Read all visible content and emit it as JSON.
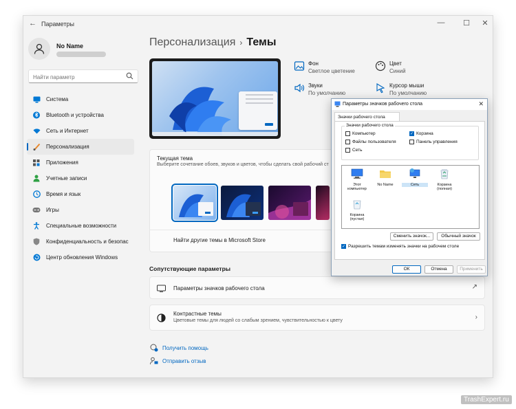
{
  "window": {
    "title": "Параметры",
    "minimize": "—",
    "maximize": "☐",
    "close": "✕",
    "back": "←"
  },
  "profile": {
    "name": "No Name"
  },
  "search": {
    "placeholder": "Найти параметр"
  },
  "sidebar": {
    "items": [
      {
        "label": "Система",
        "icon": "monitor-icon",
        "color": "#0078d4"
      },
      {
        "label": "Bluetooth и устройства",
        "icon": "bluetooth-icon",
        "color": "#0078d4"
      },
      {
        "label": "Сеть и Интернет",
        "icon": "wifi-icon",
        "color": "#0078d4"
      },
      {
        "label": "Персонализация",
        "icon": "brush-icon",
        "color": "#e8882c",
        "active": true
      },
      {
        "label": "Приложения",
        "icon": "apps-icon",
        "color": "#555555"
      },
      {
        "label": "Учетные записи",
        "icon": "person-icon",
        "color": "#2ea043"
      },
      {
        "label": "Время и язык",
        "icon": "globe-clock-icon",
        "color": "#0078d4"
      },
      {
        "label": "Игры",
        "icon": "gamepad-icon",
        "color": "#777777"
      },
      {
        "label": "Специальные возможности",
        "icon": "accessibility-icon",
        "color": "#0078d4"
      },
      {
        "label": "Конфиденциальность и безопас",
        "icon": "shield-icon",
        "color": "#777777"
      },
      {
        "label": "Центр обновления Windows",
        "icon": "update-icon",
        "color": "#0078d4"
      }
    ]
  },
  "breadcrumb": {
    "parent": "Персонализация",
    "separator": "›",
    "current": "Темы"
  },
  "properties": [
    {
      "label": "Фон",
      "value": "Светлое цветение",
      "icon": "picture-icon"
    },
    {
      "label": "Цвет",
      "value": "Синий",
      "icon": "palette-icon"
    },
    {
      "label": "Звуки",
      "value": "По умолчанию",
      "icon": "speaker-icon"
    },
    {
      "label": "Курсор мыши",
      "value": "По умолчанию",
      "icon": "cursor-icon"
    }
  ],
  "current_theme": {
    "title": "Текущая тема",
    "subtitle": "Выберите сочетание обоев, звуков и цветов, чтобы сделать свой рабочий ст",
    "store_link": "Найти другие темы в Microsoft Store"
  },
  "related": {
    "title": "Сопутствующие параметры",
    "desktop_icons": "Параметры значков рабочего стола",
    "contrast_title": "Контрастные темы",
    "contrast_sub": "Цветовые темы для людей со слабым зрением, чувствительностью к цвету",
    "external_glyph": "↗",
    "chevron": "›"
  },
  "help": {
    "get_help": "Получить помощь",
    "feedback": "Отправить отзыв"
  },
  "dialog": {
    "title": "Параметры значков рабочего стола",
    "close": "✕",
    "tab": "Значки рабочего стола",
    "group": "Значки рабочего стола",
    "checkboxes": {
      "computer": {
        "label": "Компьютер",
        "checked": false
      },
      "user_files": {
        "label": "Файлы пользователя",
        "checked": false
      },
      "network": {
        "label": "Сеть",
        "checked": false
      },
      "recycle": {
        "label": "Корзина",
        "checked": true
      },
      "control_panel": {
        "label": "Панель управления",
        "checked": false
      }
    },
    "icons": [
      {
        "label": "Этот компьютер"
      },
      {
        "label": "No Name"
      },
      {
        "label": "Сеть"
      },
      {
        "label": "Корзина (полная)"
      },
      {
        "label": "Корзина (пустая)"
      }
    ],
    "change_icon": "Сменить значок...",
    "default_icon": "Обычный значок",
    "allow_themes": {
      "label": "Разрешить темам изменять значки на рабочем столе",
      "checked": true
    },
    "ok": "ОК",
    "cancel": "Отмена",
    "apply": "Применить"
  },
  "watermark": "TrashExpert.ru",
  "colors": {
    "accent": "#0067c0",
    "brush": "#e8882c",
    "window_bg": "#f3f3f3"
  }
}
